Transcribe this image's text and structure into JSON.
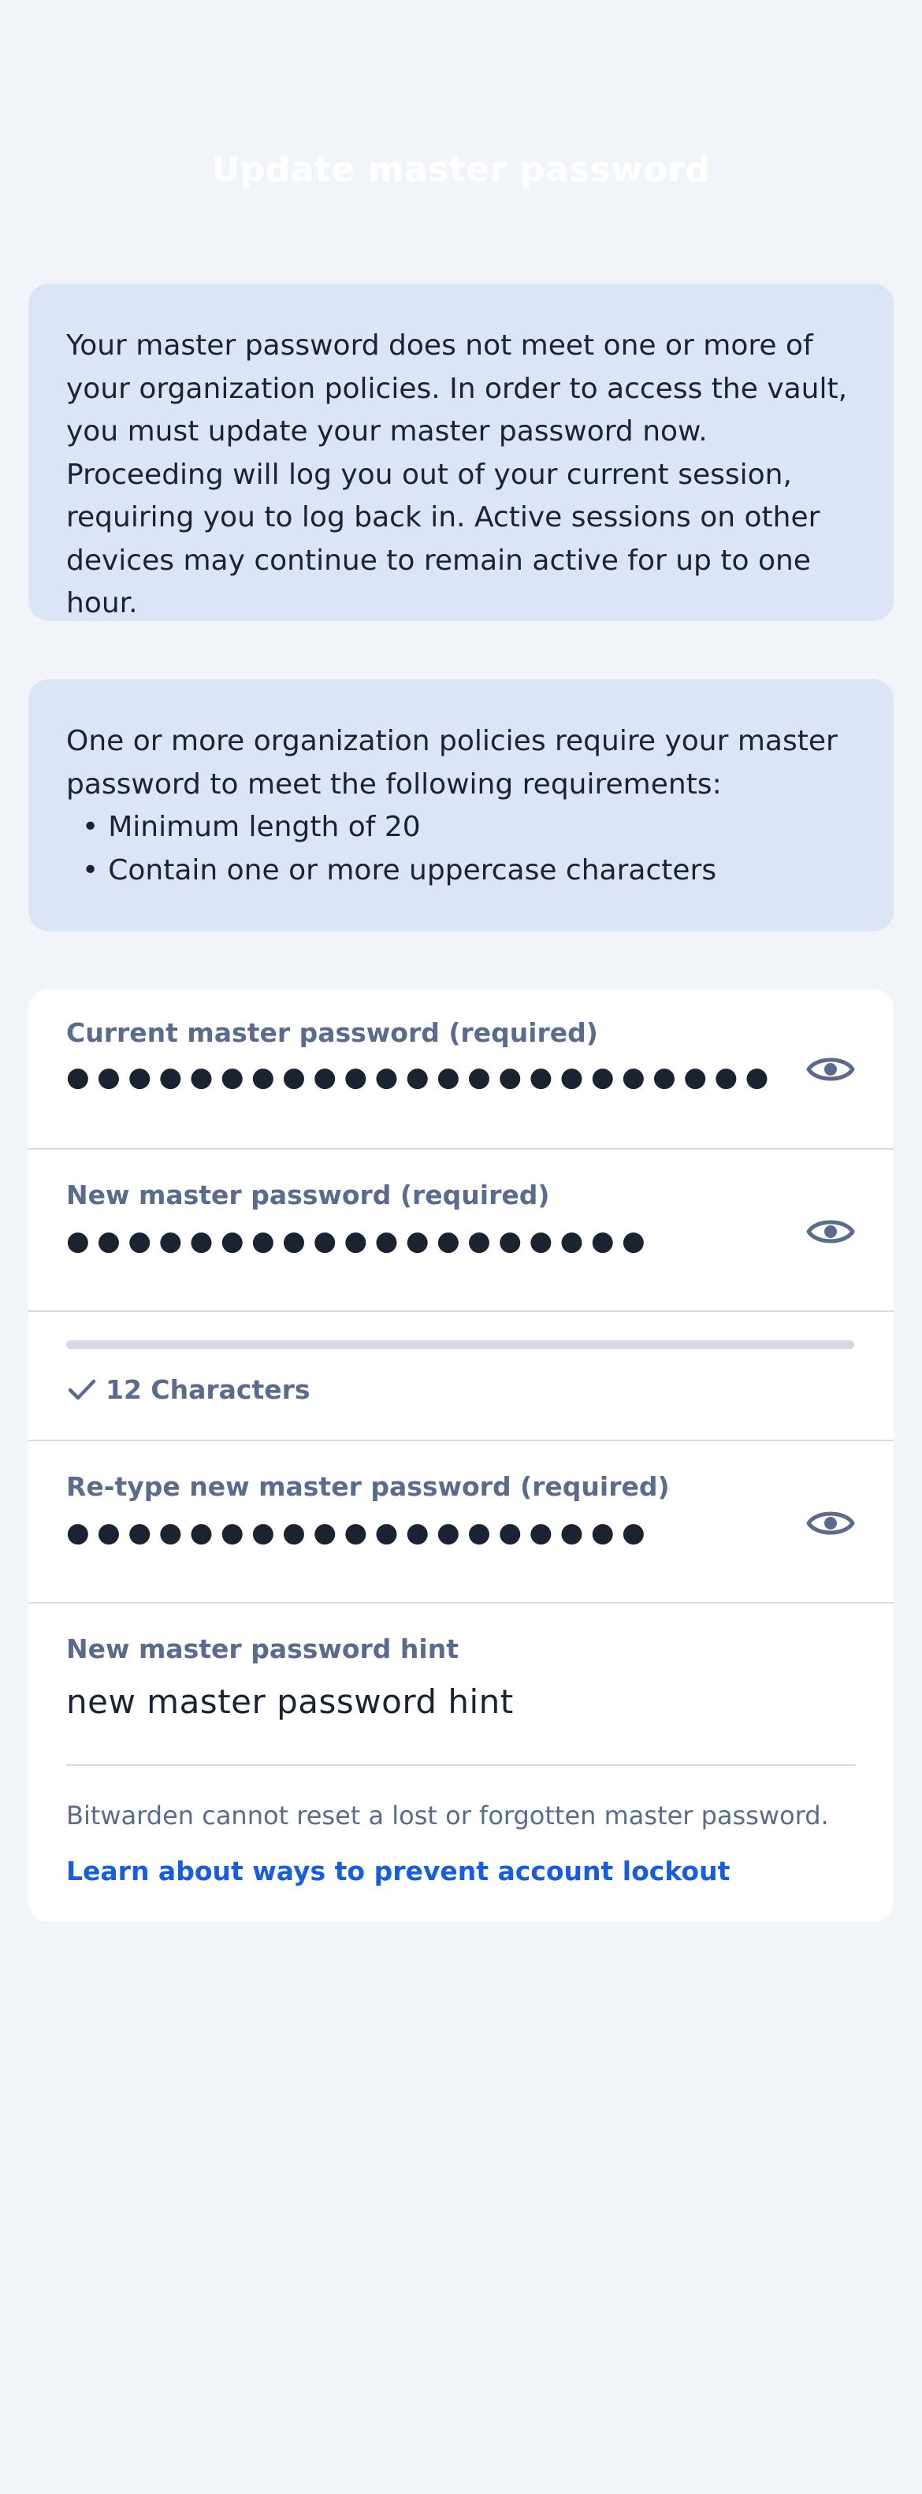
{
  "header": {
    "title": "Update master password"
  },
  "notice": {
    "text": "Your master password does not meet one or more of your organization policies. In order to access the vault, you must update your master password now. Proceeding will log you out of your current session, requiring you to log back in. Active sessions on other devices may continue to remain active for up to one hour."
  },
  "requirements": {
    "intro": "One or more organization policies require your master password to meet the following requirements:",
    "items": [
      "Minimum length of 20",
      "Contain one or more uppercase characters"
    ]
  },
  "form": {
    "current_password": {
      "label": "Current master password (required)",
      "value": "●●●●●●●●●●●●●●●●●●●●●●●",
      "icon": "eye-icon"
    },
    "new_password": {
      "label": "New master password (required)",
      "value": "●●●●●●●●●●●●●●●●●●●",
      "icon": "eye-icon"
    },
    "strength": {
      "fill_fraction": 0.0,
      "check_label": "12 Characters",
      "icon": "checkmark-icon"
    },
    "retype_password": {
      "label": "Re-type new master password (required)",
      "value": "●●●●●●●●●●●●●●●●●●●",
      "icon": "eye-icon"
    },
    "hint": {
      "label": "New master password hint",
      "value": "new master password hint"
    },
    "footer_note": "Bitwarden cannot reset a lost or forgotten master password.",
    "footer_link": "Learn about ways to prevent account lockout"
  },
  "colors": {
    "background": "#f1f5f9",
    "callout": "#dbe5f6",
    "label": "#5a6b8c",
    "link": "#175ddc"
  }
}
